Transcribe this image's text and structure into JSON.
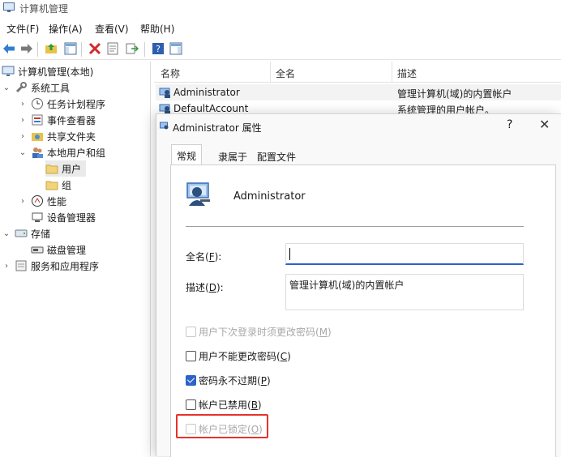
{
  "window": {
    "title": "计算机管理"
  },
  "menu": [
    {
      "label": "文件(F)"
    },
    {
      "label": "操作(A)"
    },
    {
      "label": "查看(V)"
    },
    {
      "label": "帮助(H)"
    }
  ],
  "tree": {
    "root": "计算机管理(本地)",
    "system_tools": "系统工具",
    "task_scheduler": "任务计划程序",
    "event_viewer": "事件查看器",
    "shared_folders": "共享文件夹",
    "local_users": "本地用户和组",
    "users": "用户",
    "groups": "组",
    "performance": "性能",
    "device_manager": "设备管理器",
    "storage": "存储",
    "disk_management": "磁盘管理",
    "services": "服务和应用程序"
  },
  "list": {
    "columns": [
      "名称",
      "全名",
      "描述"
    ],
    "rows": [
      {
        "name": "Administrator",
        "desc": "管理计算机(域)的内置帐户"
      },
      {
        "name": "DefaultAccount",
        "desc": "系统管理的用户帐户。"
      }
    ]
  },
  "dialog": {
    "title": "Administrator 属性",
    "help": "?",
    "close": "✕",
    "tabs": [
      "常规",
      "隶属于",
      "配置文件"
    ],
    "username": "Administrator",
    "fullname_label": "全名(",
    "fullname_key": "F",
    "fullname_tail": "):",
    "fullname_value": "",
    "desc_label": "描述(",
    "desc_key": "D",
    "desc_tail": "):",
    "desc_value": "管理计算机(域)的内置帐户",
    "options": [
      {
        "label": "用户下次登录时须更改密码(",
        "key": "M",
        "tail": ")",
        "checked": false,
        "disabled": true
      },
      {
        "label": "用户不能更改密码(",
        "key": "C",
        "tail": ")",
        "checked": false,
        "disabled": false
      },
      {
        "label": "密码永不过期(",
        "key": "P",
        "tail": ")",
        "checked": true,
        "disabled": false
      },
      {
        "label": "帐户已禁用(",
        "key": "B",
        "tail": ")",
        "checked": false,
        "disabled": false
      },
      {
        "label": "帐户已锁定(",
        "key": "O",
        "tail": ")",
        "checked": false,
        "disabled": true
      }
    ]
  },
  "colors": {
    "accent": "#2c63c7",
    "highlight": "#e6322d"
  }
}
